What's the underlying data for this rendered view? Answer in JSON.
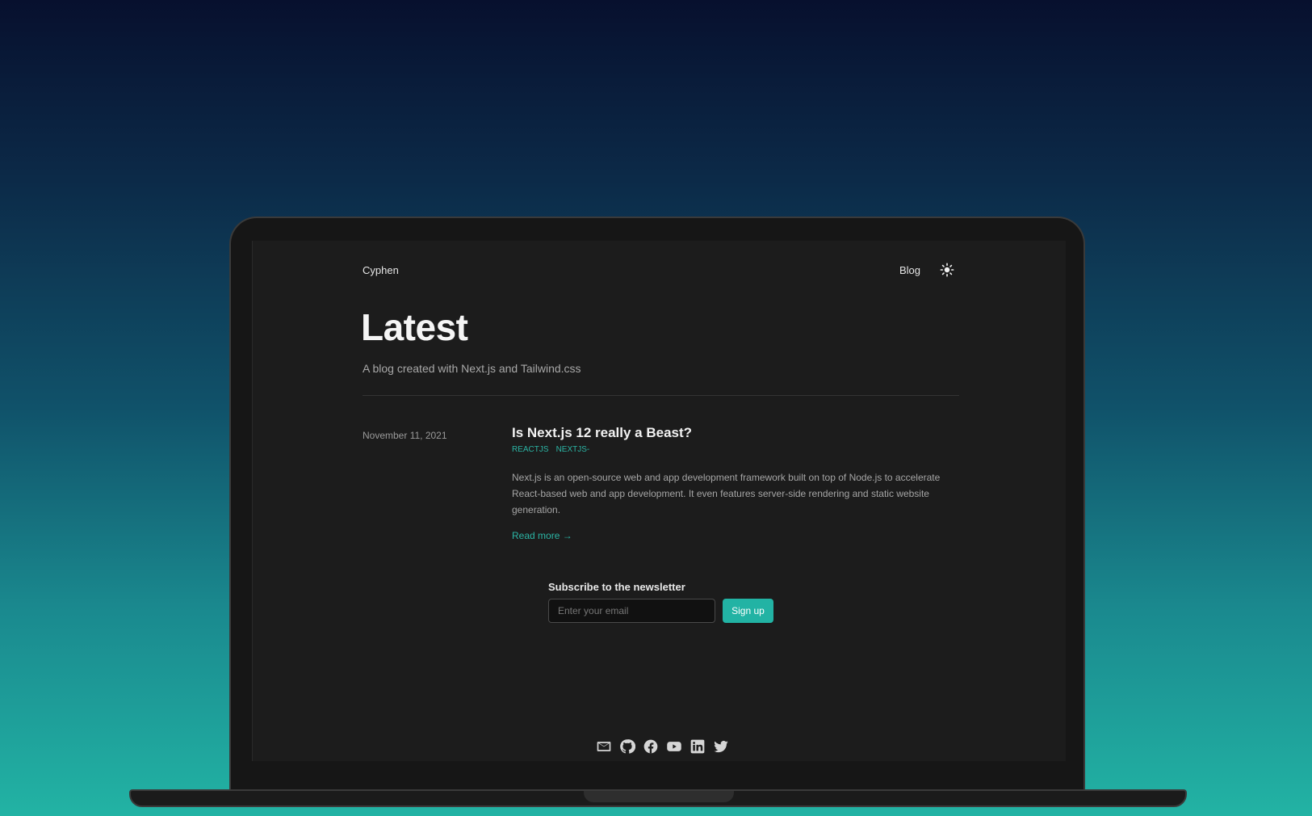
{
  "header": {
    "brand": "Cyphen",
    "nav": [
      {
        "label": "Blog"
      }
    ],
    "theme_toggle_icon": "sun-icon"
  },
  "hero": {
    "title": "Latest",
    "subtitle": "A blog created with Next.js and Tailwind.css"
  },
  "posts": [
    {
      "date": "November 11, 2021",
      "title": "Is Next.js 12 really a Beast?",
      "tags": [
        "REACTJS",
        "NEXTJS-"
      ],
      "excerpt": "Next.js is an open-source web and app development framework built on top of Node.js to accelerate React-based web and app development. It even features server-side rendering and static website generation.",
      "read_more": "Read more →"
    }
  ],
  "newsletter": {
    "title": "Subscribe to the newsletter",
    "input_placeholder": "Enter your email",
    "input_value": "",
    "button_label": "Sign up"
  },
  "footer": {
    "social_icons": [
      "mail-icon",
      "github-icon",
      "facebook-icon",
      "youtube-icon",
      "linkedin-icon",
      "twitter-icon"
    ]
  },
  "colors": {
    "accent": "#22b3a4",
    "screen_background": "#1c1c1c",
    "text_primary": "#f5f5f5",
    "text_muted": "#a5a5a5"
  }
}
